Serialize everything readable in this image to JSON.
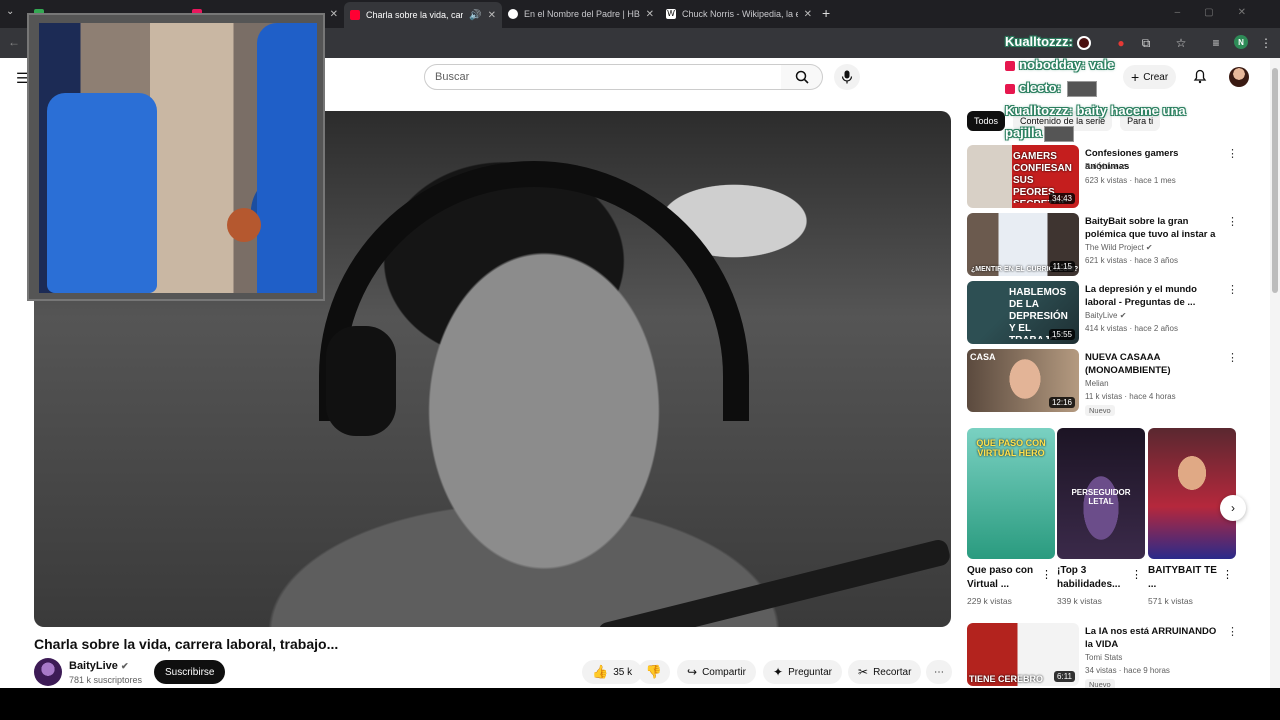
{
  "browser": {
    "tabs": [
      {
        "title": "",
        "favicon_color": "#34a853",
        "active": false
      },
      {
        "title": "",
        "favicon_color": "#e8175d",
        "active": false
      },
      {
        "title": "Charla sobre la vida, carrera",
        "favicon_color": "#ff0033",
        "active": true
      },
      {
        "title": "En el Nombre del Padre | HBO",
        "favicon_color": "#ffffff",
        "active": false
      },
      {
        "title": "Chuck Norris - Wikipedia, la en",
        "favicon_color": "#ffffff",
        "active": false
      }
    ],
    "profile_initial": "N"
  },
  "header": {
    "search_placeholder": "Buscar",
    "create_label": "Crear"
  },
  "chat": [
    {
      "user": "Kualltozzz:",
      "message": ""
    },
    {
      "user": "nobodday:",
      "message": "vale"
    },
    {
      "user": "cleeto:",
      "message": ""
    },
    {
      "user": "Kualltozzz:",
      "message": "baity haceme una"
    },
    {
      "user": "",
      "message": "pajilla"
    }
  ],
  "video": {
    "title": "Charla sobre la vida, carrera laboral, trabajo...",
    "channel": "BaityLive",
    "subscribers": "781 k suscriptores",
    "subscribe_label": "Suscribirse",
    "likes": "35 k",
    "share_label": "Compartir",
    "ask_label": "Preguntar",
    "clip_label": "Recortar"
  },
  "sidebar": {
    "chips": [
      "Todos",
      "Contenido de la serie",
      "Para ti"
    ],
    "recs_top": [
      {
        "title": "Confesiones gamers anónimas",
        "channel": "BaityLive",
        "meta": "623 k vistas · hace 1 mes",
        "duration": "34:43",
        "badge": "",
        "thumb_text": "GAMERS CONFIESAN SUS PEORES SECRETOS"
      },
      {
        "title": "BaityBait sobre la gran polémica que tuvo al instar a l...",
        "channel": "The Wild Project",
        "meta": "621 k vistas · hace 3 años",
        "duration": "11:15",
        "badge": "",
        "thumb_text": "¿MENTIR EN EL CURRICULUM?"
      },
      {
        "title": "La depresión y el mundo laboral - Preguntas de ...",
        "channel": "BaityLive",
        "meta": "414 k vistas · hace 2 años",
        "duration": "15:55",
        "badge": "",
        "thumb_text": "HABLEMOS DE LA DEPRESIÓN Y EL TRABAJO"
      },
      {
        "title": "NUEVA CASAAA (MONOAMBIENTE)",
        "channel": "Melian",
        "meta": "11 k vistas · hace 4 horas",
        "duration": "12:16",
        "badge": "Nuevo",
        "thumb_text": "CASA"
      }
    ],
    "shorts": [
      {
        "title": "Que paso con Virtual ...",
        "views": "229 k vistas",
        "thumb_text": "QUE PASO CON VIRTUAL HERO"
      },
      {
        "title": "¡Top 3 habilidades...",
        "views": "339 k vistas",
        "thumb_text": "PERSEGUIDOR LETAL"
      },
      {
        "title": "BAITYBAIT TE ...",
        "views": "571 k vistas",
        "thumb_text": ""
      }
    ],
    "recs_bottom": [
      {
        "title": "La IA nos está ARRUINANDO la VIDA",
        "channel": "Tomi Stats",
        "meta": "34 vistas · hace 9 horas",
        "duration": "6:11",
        "badge": "Nuevo",
        "thumb_text": "TIENE CEREBRO"
      }
    ]
  },
  "colors": {
    "youtube_red": "#ff0033",
    "chat_outline": "#2a7f5f",
    "subscribe_bg": "#0f0f0f"
  }
}
